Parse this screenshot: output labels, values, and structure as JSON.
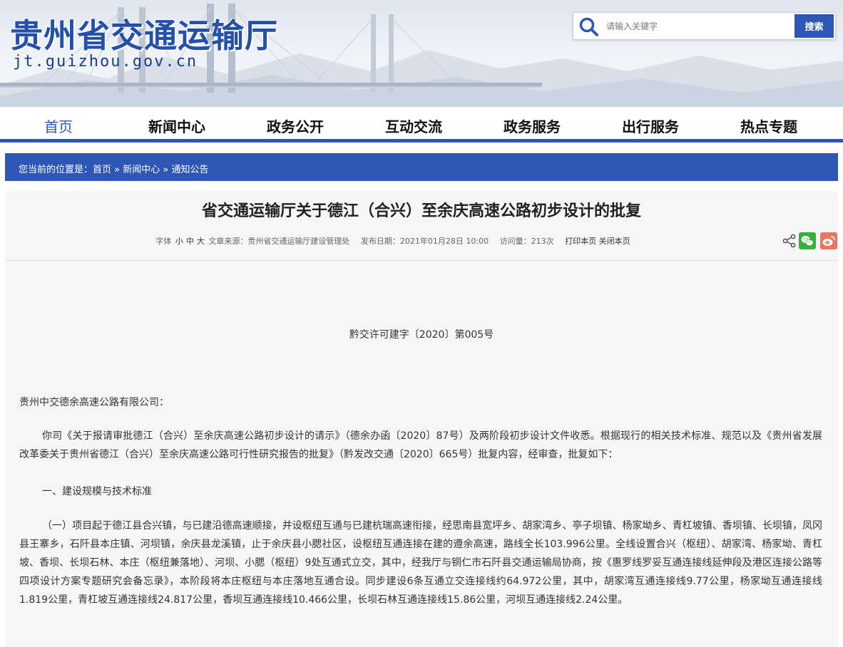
{
  "header": {
    "site_title": "贵州省交通运输厅",
    "site_domain": "jt.guizhou.gov.cn",
    "search": {
      "placeholder": "请输入关键字",
      "button_label": "搜索"
    }
  },
  "nav": {
    "items": [
      {
        "label": "首页",
        "active": true
      },
      {
        "label": "新闻中心"
      },
      {
        "label": "政务公开"
      },
      {
        "label": "互动交流"
      },
      {
        "label": "政务服务"
      },
      {
        "label": "出行服务"
      },
      {
        "label": "热点专题"
      }
    ]
  },
  "breadcrumb": {
    "prefix": "您当前的位置是：",
    "items": [
      "首页",
      "新闻中心",
      "通知公告"
    ],
    "separator": " » "
  },
  "article": {
    "title": "省交通运输厅关于德江（合兴）至余庆高速公路初步设计的批复",
    "meta": {
      "font_label": "字体",
      "size_small": "小",
      "size_medium": "中",
      "size_large": "大",
      "source": "文章来源：贵州省交通运输厅建设管理处",
      "date": "发布日期：2021年01月28日 10:00",
      "views": "访问量：213次",
      "print": "打印本页",
      "close": "关闭本页"
    },
    "share_icons": [
      "share-icon",
      "wechat-icon",
      "weibo-icon"
    ],
    "doc_number": "黔交许可建字〔2020〕第005号",
    "addressee": "贵州中交德余高速公路有限公司：",
    "paragraphs": [
      "你司《关于报请审批德江（合兴）至余庆高速公路初步设计的请示》（德余办函〔2020〕87号）及两阶段初步设计文件收悉。根据现行的相关技术标准、规范以及《贵州省发展改革委关于贵州省德江（合兴）至余庆高速公路可行性研究报告的批复》（黔发改交通〔2020〕665号）批复内容，经审查，批复如下：",
      "一、建设规模与技术标准",
      "（一）项目起于德江县合兴镇，与已建沿德高速顺接，并设枢纽互通与已建杭瑞高速衔接，经思南县宽坪乡、胡家湾乡、亭子坝镇、杨家坳乡、青杠坡镇、香坝镇、长坝镇，凤冈县王寨乡，石阡县本庄镇、河坝镇，余庆县龙溪镇，止于余庆县小腮社区，设枢纽互通连接在建的遵余高速，路线全长103.996公里。全线设置合兴（枢纽）、胡家湾、杨家坳、青杠坡、香坝、长坝石林、本庄（枢纽兼落地）、河坝、小腮（枢纽）9处互通式立交，其中，经我厅与铜仁市石阡县交通运输局协商，按《惠罗线罗妥互通连接线延伸段及港区连接公路等四项设计方案专题研究会备忘录》，本阶段将本庄枢纽与本庄落地互通合设。同步建设6条互通立交连接线约64.972公里，其中，胡家湾互通连接线9.77公里，杨家坳互通连接线1.819公里，青杠坡互通连接线24.817公里，香坝互通连接线10.466公里，长坝石林互通连接线15.86公里，河坝互通连接线2.24公里。"
    ]
  },
  "colors": {
    "accent": "#2d56b5",
    "title_blue": "#2550a8",
    "article_bg": "#f6f6f6",
    "wechat_green": "#33b23a",
    "weibo_red": "#e8765d"
  }
}
